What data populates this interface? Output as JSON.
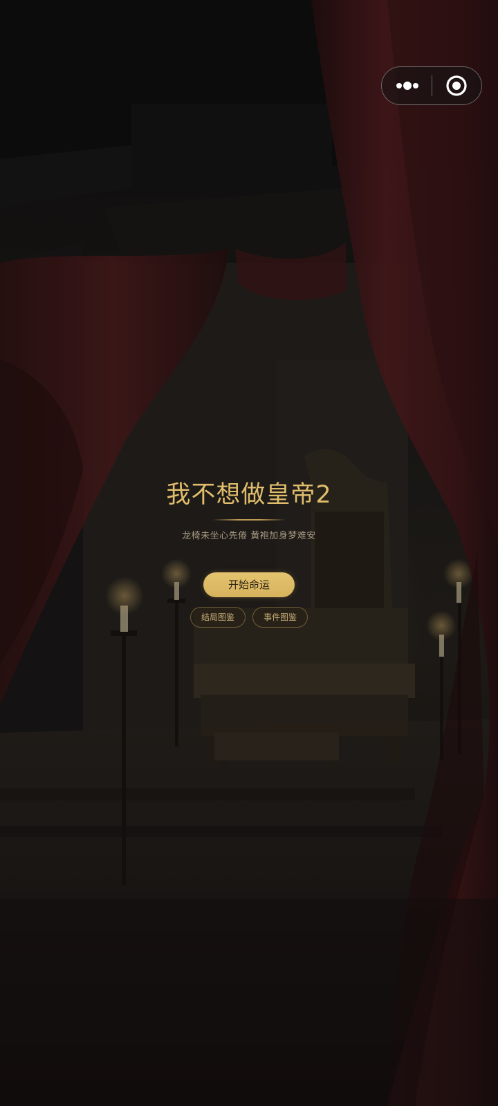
{
  "capsule_menu": {
    "more_icon": "more-dots-icon",
    "close_icon": "target-circle-icon"
  },
  "game": {
    "title": "我不想做皇帝2",
    "subtitle": "龙椅未坐心先倦 黄袍加身梦难安",
    "start_label": "开始命运",
    "endings_label": "结局图鉴",
    "events_label": "事件图鉴"
  },
  "colors": {
    "title_gold": "#e0bd6c",
    "button_gold": "#d9b45f",
    "curtain_red": "#5a1e1e",
    "background_dark": "#1a1616"
  }
}
